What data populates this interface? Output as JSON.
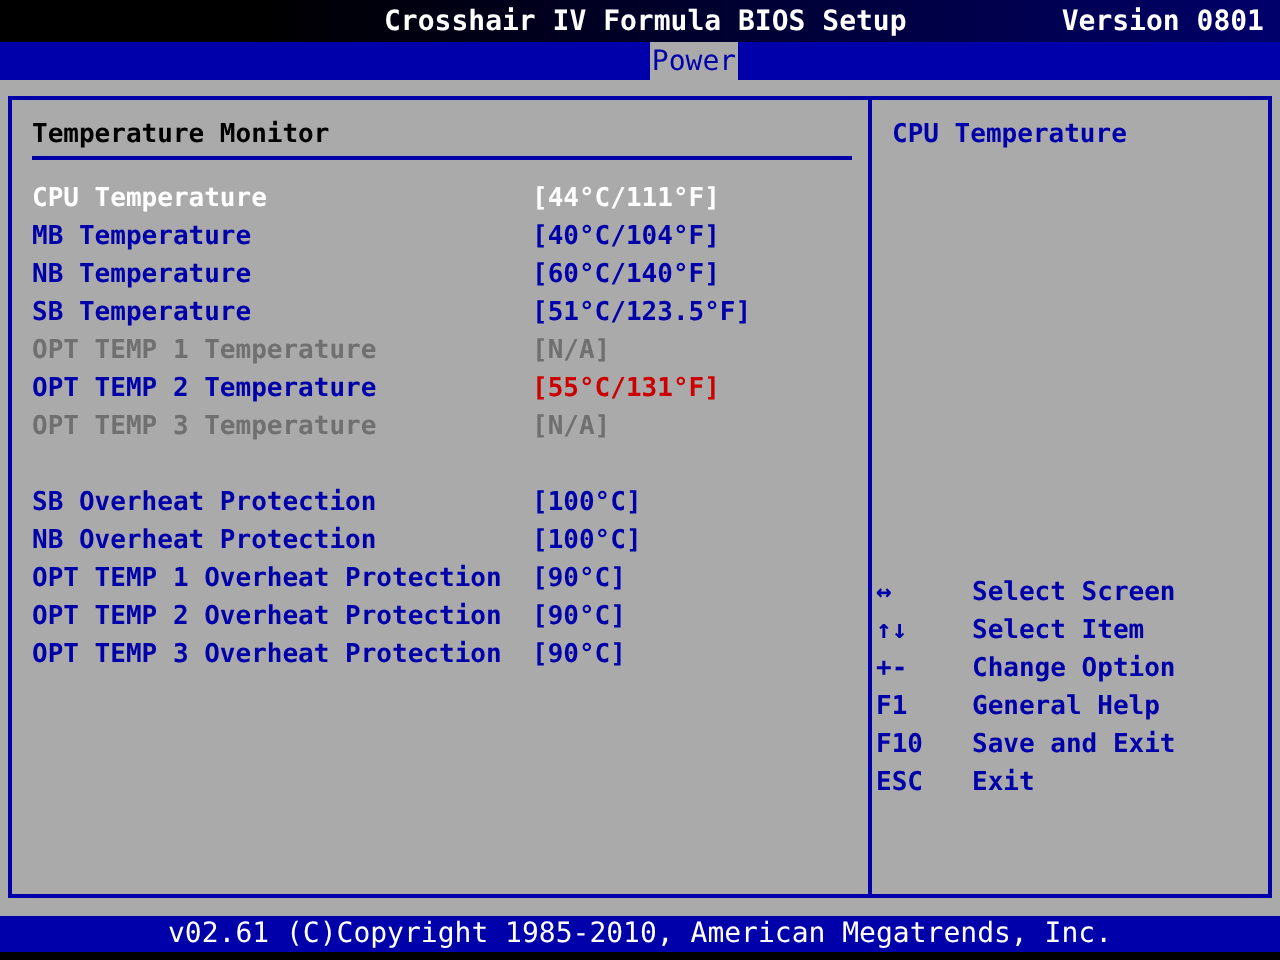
{
  "window": {
    "title": "Crosshair IV Formula BIOS Setup",
    "version": "Version 0801"
  },
  "tabs": [
    {
      "label": "Power",
      "selected": true
    }
  ],
  "panel": {
    "title": "Temperature Monitor",
    "groups": [
      {
        "rows": [
          {
            "label": "CPU Temperature",
            "value": "[44°C/111°F]",
            "selected": true,
            "disabled": false,
            "warning": false
          },
          {
            "label": "MB Temperature",
            "value": "[40°C/104°F]",
            "selected": false,
            "disabled": false,
            "warning": false
          },
          {
            "label": "NB Temperature",
            "value": "[60°C/140°F]",
            "selected": false,
            "disabled": false,
            "warning": false
          },
          {
            "label": "SB Temperature",
            "value": "[51°C/123.5°F]",
            "selected": false,
            "disabled": false,
            "warning": false
          },
          {
            "label": "OPT TEMP 1 Temperature",
            "value": "[N/A]",
            "selected": false,
            "disabled": true,
            "warning": false
          },
          {
            "label": "OPT TEMP 2 Temperature",
            "value": "[55°C/131°F]",
            "selected": false,
            "disabled": false,
            "warning": true
          },
          {
            "label": "OPT TEMP 3 Temperature",
            "value": "[N/A]",
            "selected": false,
            "disabled": true,
            "warning": false
          }
        ]
      },
      {
        "rows": [
          {
            "label": "SB Overheat Protection",
            "value": "[100°C]",
            "selected": false,
            "disabled": false,
            "warning": false
          },
          {
            "label": "NB Overheat Protection",
            "value": "[100°C]",
            "selected": false,
            "disabled": false,
            "warning": false
          },
          {
            "label": "OPT TEMP 1 Overheat Protection",
            "value": "[90°C]",
            "selected": false,
            "disabled": false,
            "warning": false
          },
          {
            "label": "OPT TEMP 2 Overheat Protection",
            "value": "[90°C]",
            "selected": false,
            "disabled": false,
            "warning": false
          },
          {
            "label": "OPT TEMP 3 Overheat Protection",
            "value": "[90°C]",
            "selected": false,
            "disabled": false,
            "warning": false
          }
        ]
      }
    ]
  },
  "help": {
    "text": "CPU Temperature",
    "keys": [
      {
        "key": "↔",
        "action": "Select Screen"
      },
      {
        "key": "↑↓",
        "action": "Select Item"
      },
      {
        "key": "+-",
        "action": "Change Option"
      },
      {
        "key": "F1",
        "action": "General Help"
      },
      {
        "key": "F10",
        "action": "Save and Exit"
      },
      {
        "key": "ESC",
        "action": "Exit"
      }
    ]
  },
  "status_bar": "v02.61 (C)Copyright 1985-2010, American Megatrends, Inc."
}
